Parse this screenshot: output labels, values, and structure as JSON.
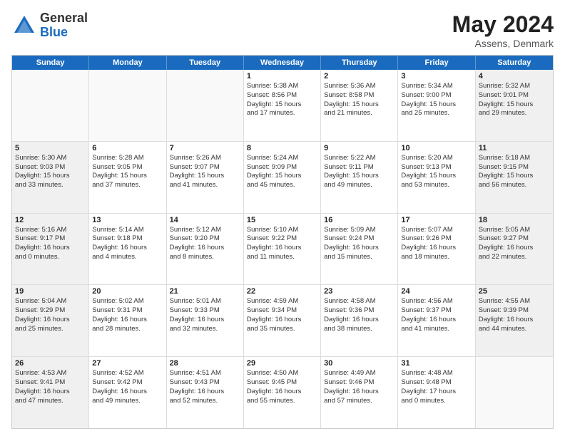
{
  "logo": {
    "general": "General",
    "blue": "Blue"
  },
  "title": {
    "month_year": "May 2024",
    "location": "Assens, Denmark"
  },
  "weekdays": [
    "Sunday",
    "Monday",
    "Tuesday",
    "Wednesday",
    "Thursday",
    "Friday",
    "Saturday"
  ],
  "rows": [
    [
      {
        "day": "",
        "info": "",
        "empty": true
      },
      {
        "day": "",
        "info": "",
        "empty": true
      },
      {
        "day": "",
        "info": "",
        "empty": true
      },
      {
        "day": "1",
        "info": "Sunrise: 5:38 AM\nSunset: 8:56 PM\nDaylight: 15 hours\nand 17 minutes.",
        "empty": false
      },
      {
        "day": "2",
        "info": "Sunrise: 5:36 AM\nSunset: 8:58 PM\nDaylight: 15 hours\nand 21 minutes.",
        "empty": false
      },
      {
        "day": "3",
        "info": "Sunrise: 5:34 AM\nSunset: 9:00 PM\nDaylight: 15 hours\nand 25 minutes.",
        "empty": false
      },
      {
        "day": "4",
        "info": "Sunrise: 5:32 AM\nSunset: 9:01 PM\nDaylight: 15 hours\nand 29 minutes.",
        "empty": false,
        "shaded": true
      }
    ],
    [
      {
        "day": "5",
        "info": "Sunrise: 5:30 AM\nSunset: 9:03 PM\nDaylight: 15 hours\nand 33 minutes.",
        "empty": false,
        "shaded": true
      },
      {
        "day": "6",
        "info": "Sunrise: 5:28 AM\nSunset: 9:05 PM\nDaylight: 15 hours\nand 37 minutes.",
        "empty": false
      },
      {
        "day": "7",
        "info": "Sunrise: 5:26 AM\nSunset: 9:07 PM\nDaylight: 15 hours\nand 41 minutes.",
        "empty": false
      },
      {
        "day": "8",
        "info": "Sunrise: 5:24 AM\nSunset: 9:09 PM\nDaylight: 15 hours\nand 45 minutes.",
        "empty": false
      },
      {
        "day": "9",
        "info": "Sunrise: 5:22 AM\nSunset: 9:11 PM\nDaylight: 15 hours\nand 49 minutes.",
        "empty": false
      },
      {
        "day": "10",
        "info": "Sunrise: 5:20 AM\nSunset: 9:13 PM\nDaylight: 15 hours\nand 53 minutes.",
        "empty": false
      },
      {
        "day": "11",
        "info": "Sunrise: 5:18 AM\nSunset: 9:15 PM\nDaylight: 15 hours\nand 56 minutes.",
        "empty": false,
        "shaded": true
      }
    ],
    [
      {
        "day": "12",
        "info": "Sunrise: 5:16 AM\nSunset: 9:17 PM\nDaylight: 16 hours\nand 0 minutes.",
        "empty": false,
        "shaded": true
      },
      {
        "day": "13",
        "info": "Sunrise: 5:14 AM\nSunset: 9:18 PM\nDaylight: 16 hours\nand 4 minutes.",
        "empty": false
      },
      {
        "day": "14",
        "info": "Sunrise: 5:12 AM\nSunset: 9:20 PM\nDaylight: 16 hours\nand 8 minutes.",
        "empty": false
      },
      {
        "day": "15",
        "info": "Sunrise: 5:10 AM\nSunset: 9:22 PM\nDaylight: 16 hours\nand 11 minutes.",
        "empty": false
      },
      {
        "day": "16",
        "info": "Sunrise: 5:09 AM\nSunset: 9:24 PM\nDaylight: 16 hours\nand 15 minutes.",
        "empty": false
      },
      {
        "day": "17",
        "info": "Sunrise: 5:07 AM\nSunset: 9:26 PM\nDaylight: 16 hours\nand 18 minutes.",
        "empty": false
      },
      {
        "day": "18",
        "info": "Sunrise: 5:05 AM\nSunset: 9:27 PM\nDaylight: 16 hours\nand 22 minutes.",
        "empty": false,
        "shaded": true
      }
    ],
    [
      {
        "day": "19",
        "info": "Sunrise: 5:04 AM\nSunset: 9:29 PM\nDaylight: 16 hours\nand 25 minutes.",
        "empty": false,
        "shaded": true
      },
      {
        "day": "20",
        "info": "Sunrise: 5:02 AM\nSunset: 9:31 PM\nDaylight: 16 hours\nand 28 minutes.",
        "empty": false
      },
      {
        "day": "21",
        "info": "Sunrise: 5:01 AM\nSunset: 9:33 PM\nDaylight: 16 hours\nand 32 minutes.",
        "empty": false
      },
      {
        "day": "22",
        "info": "Sunrise: 4:59 AM\nSunset: 9:34 PM\nDaylight: 16 hours\nand 35 minutes.",
        "empty": false
      },
      {
        "day": "23",
        "info": "Sunrise: 4:58 AM\nSunset: 9:36 PM\nDaylight: 16 hours\nand 38 minutes.",
        "empty": false
      },
      {
        "day": "24",
        "info": "Sunrise: 4:56 AM\nSunset: 9:37 PM\nDaylight: 16 hours\nand 41 minutes.",
        "empty": false
      },
      {
        "day": "25",
        "info": "Sunrise: 4:55 AM\nSunset: 9:39 PM\nDaylight: 16 hours\nand 44 minutes.",
        "empty": false,
        "shaded": true
      }
    ],
    [
      {
        "day": "26",
        "info": "Sunrise: 4:53 AM\nSunset: 9:41 PM\nDaylight: 16 hours\nand 47 minutes.",
        "empty": false,
        "shaded": true
      },
      {
        "day": "27",
        "info": "Sunrise: 4:52 AM\nSunset: 9:42 PM\nDaylight: 16 hours\nand 49 minutes.",
        "empty": false
      },
      {
        "day": "28",
        "info": "Sunrise: 4:51 AM\nSunset: 9:43 PM\nDaylight: 16 hours\nand 52 minutes.",
        "empty": false
      },
      {
        "day": "29",
        "info": "Sunrise: 4:50 AM\nSunset: 9:45 PM\nDaylight: 16 hours\nand 55 minutes.",
        "empty": false
      },
      {
        "day": "30",
        "info": "Sunrise: 4:49 AM\nSunset: 9:46 PM\nDaylight: 16 hours\nand 57 minutes.",
        "empty": false
      },
      {
        "day": "31",
        "info": "Sunrise: 4:48 AM\nSunset: 9:48 PM\nDaylight: 17 hours\nand 0 minutes.",
        "empty": false
      },
      {
        "day": "",
        "info": "",
        "empty": true,
        "shaded": true
      }
    ]
  ]
}
